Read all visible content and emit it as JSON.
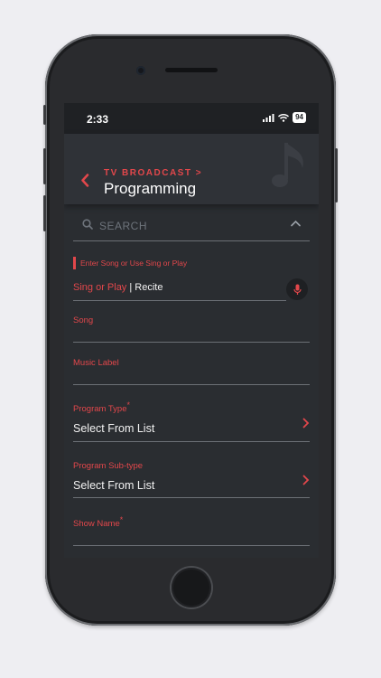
{
  "status_bar": {
    "time": "2:33",
    "battery": "94"
  },
  "header": {
    "breadcrumb": "TV BROADCAST >",
    "title": "Programming"
  },
  "search": {
    "placeholder": "SEARCH"
  },
  "form": {
    "hint": "Enter Song or Use Sing or Play",
    "sing_or_play": "Sing or Play",
    "separator": "|",
    "recite": "Recite",
    "song_label": "Song",
    "music_label_label": "Music Label",
    "program_type_label": "Program Type",
    "program_type_value": "Select From List",
    "program_subtype_label": "Program Sub-type",
    "program_subtype_value": "Select From List",
    "show_name_label": "Show Name",
    "required_mark": "*"
  },
  "colors": {
    "accent": "#e2474b",
    "background": "#2a2d31",
    "header": "#2f3237"
  }
}
